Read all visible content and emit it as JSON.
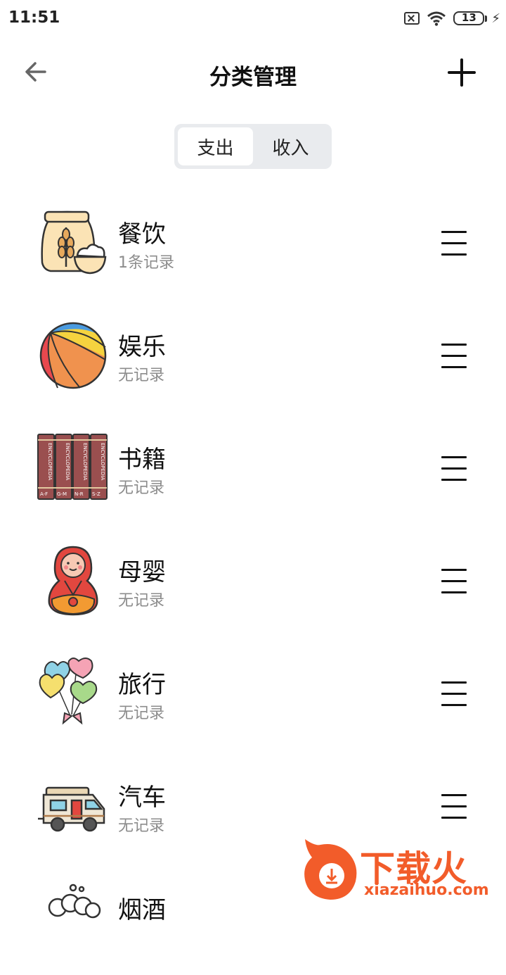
{
  "status": {
    "time": "11:51",
    "battery": "13"
  },
  "header": {
    "title": "分类管理"
  },
  "tabs": [
    {
      "label": "支出",
      "active": true
    },
    {
      "label": "收入",
      "active": false
    }
  ],
  "categories": [
    {
      "name": "餐饮",
      "records": "1条记录",
      "icon": "flour-sack-icon"
    },
    {
      "name": "娱乐",
      "records": "无记录",
      "icon": "beach-ball-icon"
    },
    {
      "name": "书籍",
      "records": "无记录",
      "icon": "encyclopedia-books-icon"
    },
    {
      "name": "母婴",
      "records": "无记录",
      "icon": "matryoshka-doll-icon"
    },
    {
      "name": "旅行",
      "records": "无记录",
      "icon": "heart-balloons-icon"
    },
    {
      "name": "汽车",
      "records": "无记录",
      "icon": "camper-van-icon"
    },
    {
      "name": "烟酒",
      "records": "",
      "icon": "beer-foam-icon"
    }
  ],
  "books": [
    "A-F",
    "G-M",
    "N-R",
    "S-Z"
  ],
  "book_spine": "ENCYCLOPEDIA",
  "watermark": {
    "text": "下载火",
    "url": "xiazaihuo.com"
  }
}
